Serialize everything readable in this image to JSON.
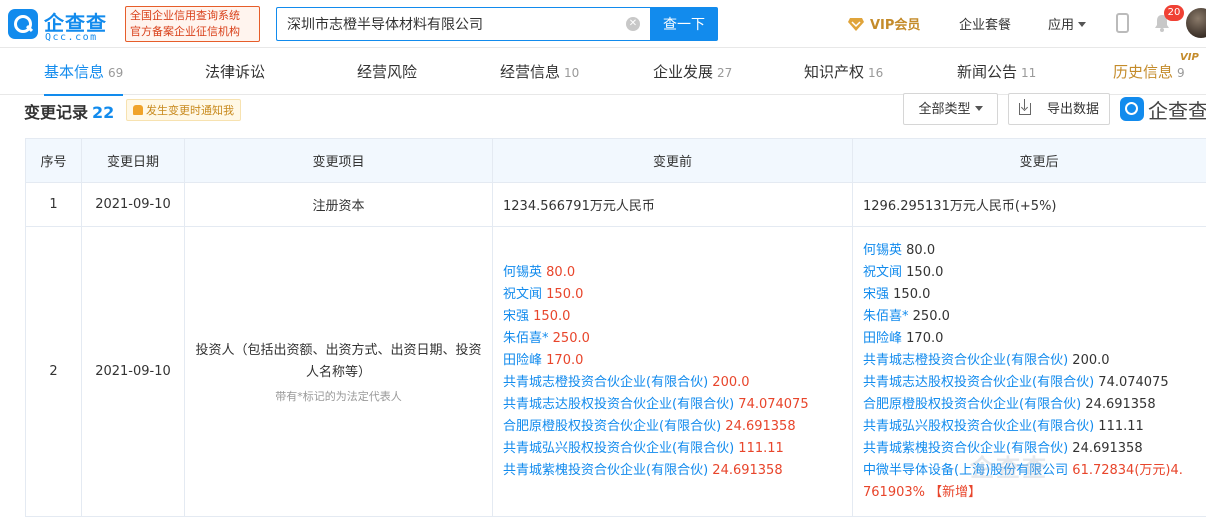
{
  "header": {
    "logo_name": "企查查",
    "logo_sub": "Qcc.com",
    "badge_line1": "全国企业信用查询系统",
    "badge_line2": "官方备案企业征信机构",
    "search_value": "深圳市志橙半导体材料有限公司",
    "search_button": "查一下",
    "vip_label": "VIP会员",
    "menu_package": "企业套餐",
    "menu_apps": "应用",
    "notifications": "20"
  },
  "tabs": [
    {
      "label": "基本信息",
      "count": "69"
    },
    {
      "label": "法律诉讼",
      "count": ""
    },
    {
      "label": "经营风险",
      "count": ""
    },
    {
      "label": "经营信息",
      "count": "10"
    },
    {
      "label": "企业发展",
      "count": "27"
    },
    {
      "label": "知识产权",
      "count": "16"
    },
    {
      "label": "新闻公告",
      "count": "11"
    },
    {
      "label": "历史信息",
      "count": "9"
    }
  ],
  "vip_tag": "VIP",
  "section": {
    "title": "变更记录",
    "count": "22",
    "notify_label": "发生变更时通知我",
    "type_button": "全部类型",
    "export_button": "导出数据",
    "brand": "企查查"
  },
  "table": {
    "headers": [
      "序号",
      "变更日期",
      "变更项目",
      "变更前",
      "变更后"
    ],
    "row1": {
      "index": "1",
      "date": "2021-09-10",
      "item": "注册资本",
      "before": "1234.566791万元人民币",
      "after": "1296.295131万元人民币(+5%)"
    },
    "row2": {
      "index": "2",
      "date": "2021-09-10",
      "item": "投资人（包括出资额、出资方式、出资日期、投资人名称等）",
      "note": "带有*标记的为法定代表人",
      "before": [
        {
          "name": "何锡英",
          "value": "80.0"
        },
        {
          "name": "祝文闻",
          "value": "150.0"
        },
        {
          "name": "宋强",
          "value": "150.0"
        },
        {
          "name": "朱佰喜*",
          "value": "250.0"
        },
        {
          "name": "田险峰",
          "value": "170.0"
        },
        {
          "name": "共青城志橙投资合伙企业(有限合伙)",
          "value": "200.0"
        },
        {
          "name": "共青城志达股权投资合伙企业(有限合伙)",
          "value": "74.074075"
        },
        {
          "name": "合肥原橙股权投资合伙企业(有限合伙)",
          "value": "24.691358"
        },
        {
          "name": "共青城弘兴股权投资合伙企业(有限合伙)",
          "value": "111.11"
        },
        {
          "name": "共青城紫槐投资合伙企业(有限合伙)",
          "value": "24.691358"
        }
      ],
      "after": [
        {
          "name": "何锡英",
          "value": "80.0"
        },
        {
          "name": "祝文闻",
          "value": "150.0"
        },
        {
          "name": "宋强",
          "value": "150.0"
        },
        {
          "name": "朱佰喜*",
          "value": "250.0"
        },
        {
          "name": "田险峰",
          "value": "170.0"
        },
        {
          "name": "共青城志橙投资合伙企业(有限合伙)",
          "value": "200.0"
        },
        {
          "name": "共青城志达股权投资合伙企业(有限合伙)",
          "value": "74.074075"
        },
        {
          "name": "合肥原橙股权投资合伙企业(有限合伙)",
          "value": "24.691358"
        },
        {
          "name": "共青城弘兴股权投资合伙企业(有限合伙)",
          "value": "111.11"
        },
        {
          "name": "共青城紫槐投资合伙企业(有限合伙)",
          "value": "24.691358"
        }
      ],
      "after_new_name": "中微半导体设备(上海)股份有限公司",
      "after_new_value1": "61.72834(万元)4.",
      "after_new_value2": "761903%",
      "after_new_tag": "【新增】"
    }
  },
  "colors": {
    "accent": "#128bed",
    "changed": "#e8452b",
    "vip": "#c48b2a"
  }
}
